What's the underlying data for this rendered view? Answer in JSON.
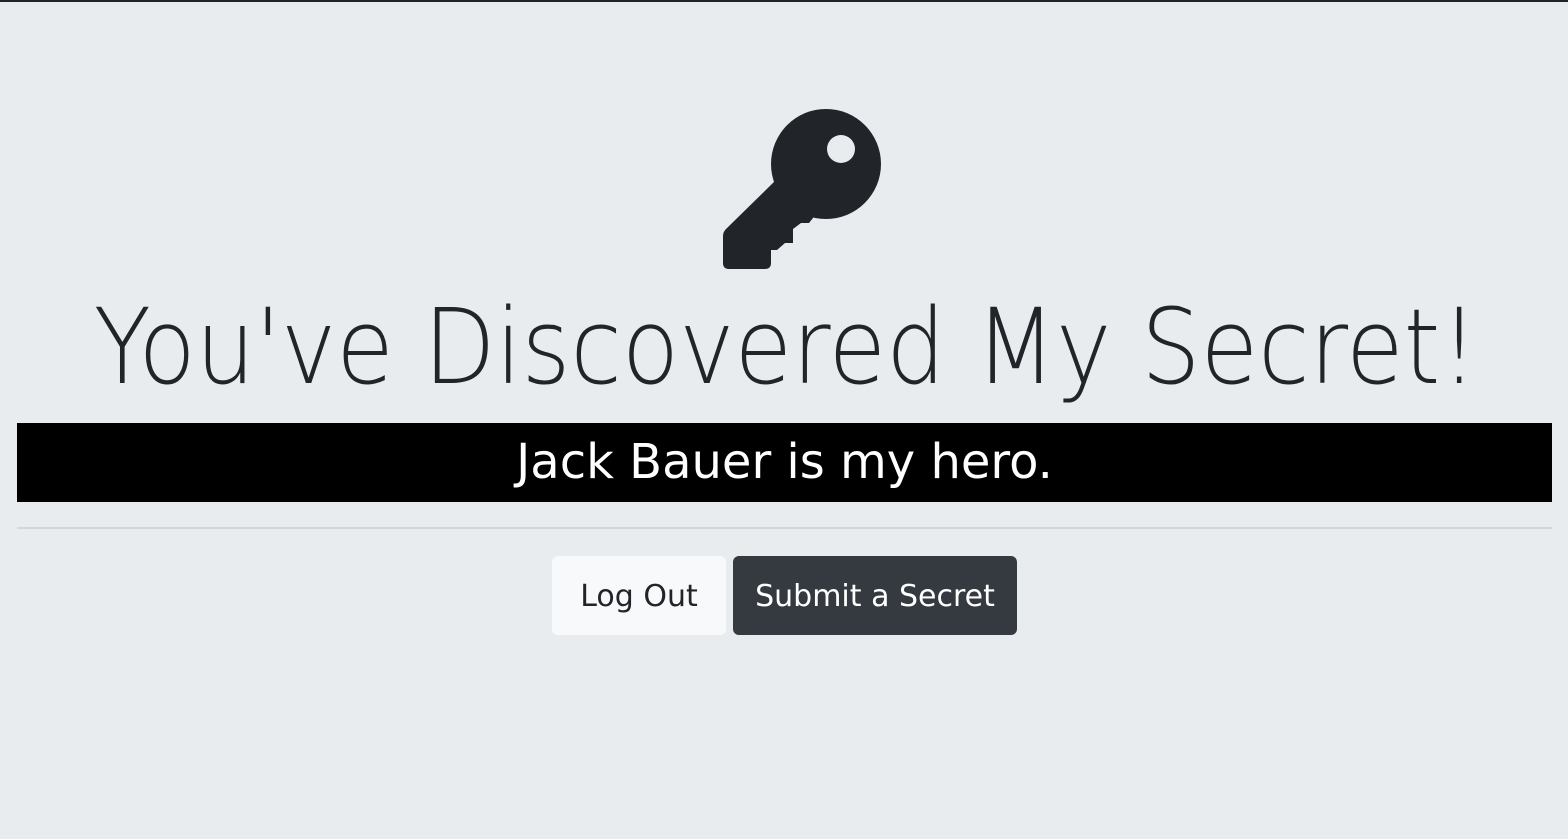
{
  "icon": {
    "name": "key-icon",
    "color": "#212529"
  },
  "page": {
    "title": "You've Discovered My Secret!",
    "secret": "Jack Bauer is my hero."
  },
  "actions": {
    "logout_label": "Log Out",
    "submit_label": "Submit a Secret"
  },
  "colors": {
    "background": "#e9ecef",
    "text": "#212529",
    "secret_bg": "#000000",
    "secret_text": "#ffffff",
    "light_button": "#f8f9fa",
    "dark_button": "#343a40"
  }
}
